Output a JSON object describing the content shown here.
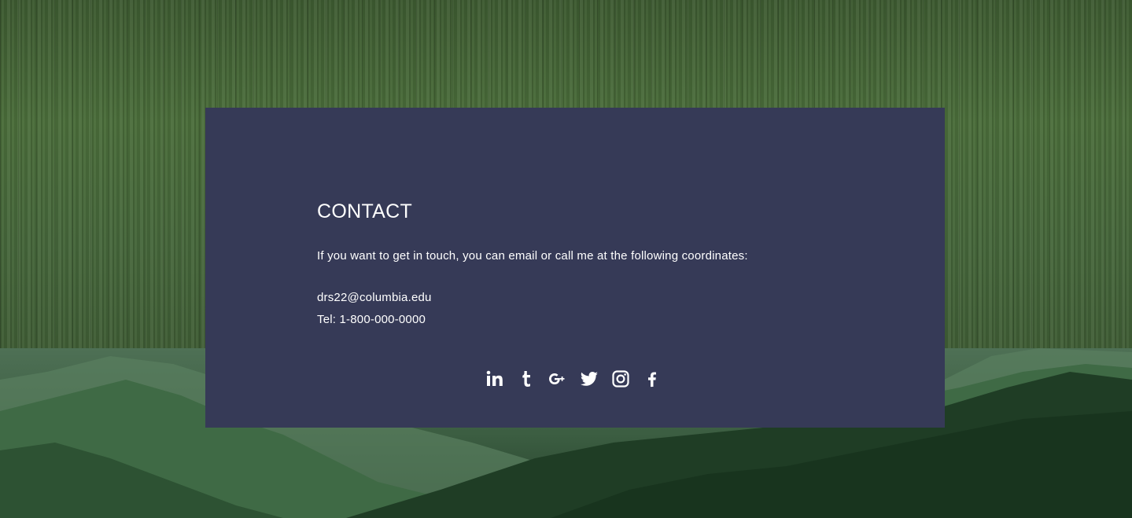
{
  "contact": {
    "title": "CONTACT",
    "intro": "If you want to get in touch, you can email or call me at the following coordinates:",
    "email": "drs22@columbia.edu",
    "phone": "Tel: 1-800-000-0000"
  },
  "social": [
    {
      "icon": "linkedin-icon"
    },
    {
      "icon": "tumblr-icon"
    },
    {
      "icon": "google-plus-icon"
    },
    {
      "icon": "twitter-icon"
    },
    {
      "icon": "instagram-icon"
    },
    {
      "icon": "facebook-icon"
    }
  ],
  "colors": {
    "card_background": "#363a57",
    "text": "#ffffff",
    "forest_top": "#4a6d3a",
    "forest_bottom": "#24402a"
  }
}
